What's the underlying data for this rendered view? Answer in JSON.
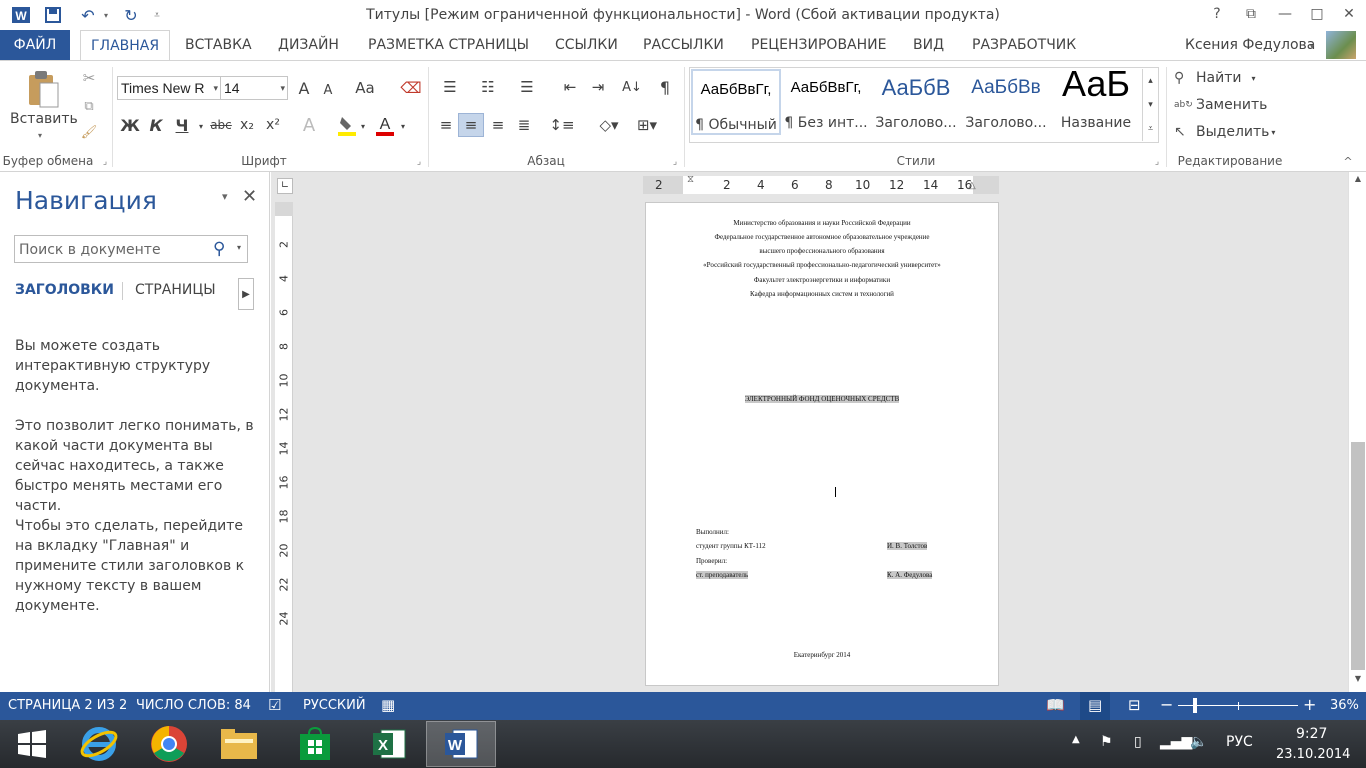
{
  "window": {
    "title": "Титулы [Режим ограниченной функциональности] - Word (Сбой активации продукта)",
    "help": "?",
    "minimize": "—",
    "maximize": "□",
    "close": "✕"
  },
  "tabs": {
    "file": "ФАЙЛ",
    "items": [
      "ГЛАВНАЯ",
      "ВСТАВКА",
      "ДИЗАЙН",
      "РАЗМЕТКА СТРАНИЦЫ",
      "ССЫЛКИ",
      "РАССЫЛКИ",
      "РЕЦЕНЗИРОВАНИЕ",
      "ВИД",
      "РАЗРАБОТЧИК"
    ],
    "user": "Ксения Федулова"
  },
  "ribbon": {
    "clipboard": {
      "paste": "Вставить",
      "label": "Буфер обмена"
    },
    "font": {
      "name": "Times New R",
      "size": "14",
      "label": "Шрифт",
      "bold": "Ж",
      "italic": "К",
      "underline": "Ч",
      "strike": "abc",
      "sub": "x₂",
      "sup": "x²",
      "case": "Aa",
      "grow": "A",
      "shrink": "A"
    },
    "paragraph": {
      "label": "Абзац"
    },
    "styles": {
      "label": "Стили",
      "items": [
        {
          "sample": "АаБбВвГг,",
          "name": "¶ Обычный"
        },
        {
          "sample": "АаБбВвГг,",
          "name": "¶ Без инт..."
        },
        {
          "sample": "АаБбВ",
          "name": "Заголово..."
        },
        {
          "sample": "АаБбВв",
          "name": "Заголово..."
        },
        {
          "sample": "АаБ",
          "name": "Название"
        }
      ]
    },
    "editing": {
      "find": "Найти",
      "replace": "Заменить",
      "select": "Выделить",
      "label": "Редактирование"
    }
  },
  "nav": {
    "title": "Навигация",
    "search_placeholder": "Поиск в документе",
    "tab_headings": "ЗАГОЛОВКИ",
    "tab_pages": "СТРАНИЦЫ",
    "text1": "Вы можете создать интерактивную структуру документа.",
    "text2": "Это позволит легко понимать, в какой части документа вы сейчас находитесь, а также быстро менять местами его части.",
    "text3": "Чтобы это сделать, перейдите на вкладку \"Главная\" и примените стили заголовков к нужному тексту в вашем документе."
  },
  "ruler": {
    "h": [
      "2",
      "2",
      "4",
      "6",
      "8",
      "10",
      "12",
      "14",
      "16"
    ],
    "v": [
      "2",
      "4",
      "6",
      "8",
      "10",
      "12",
      "14",
      "16",
      "18",
      "20",
      "22",
      "24"
    ]
  },
  "document": {
    "header_lines": [
      "Министерство образования и науки Российской Федерации",
      "Федеральное государственное автономное образовательное учреждение",
      "высшего профессионального образования",
      "«Российский государственный профессионально-педагогический университет»",
      "Факультет электроэнергетики и информатики",
      "Кафедра информационных систем и технологий"
    ],
    "title": "ЭЛЕКТРОННЫЙ ФОНД ОЦЕНОЧНЫХ СРЕДСТВ",
    "done_by": "Выполнил:",
    "student": "студент группы КТ-112",
    "student_name": "И. В. Толстов",
    "checked_by": "Проверил:",
    "teacher": "ст. преподаватель",
    "teacher_name": "К. А. Федулова",
    "city": "Екатеринбург 2014"
  },
  "status": {
    "page": "СТРАНИЦА 2 ИЗ 2",
    "words": "ЧИСЛО СЛОВ: 84",
    "lang": "РУССКИЙ",
    "zoom": "36%"
  },
  "taskbar": {
    "lang": "РУС",
    "time": "9:27",
    "date": "23.10.2014"
  },
  "colors": {
    "accent": "#2b579a"
  }
}
